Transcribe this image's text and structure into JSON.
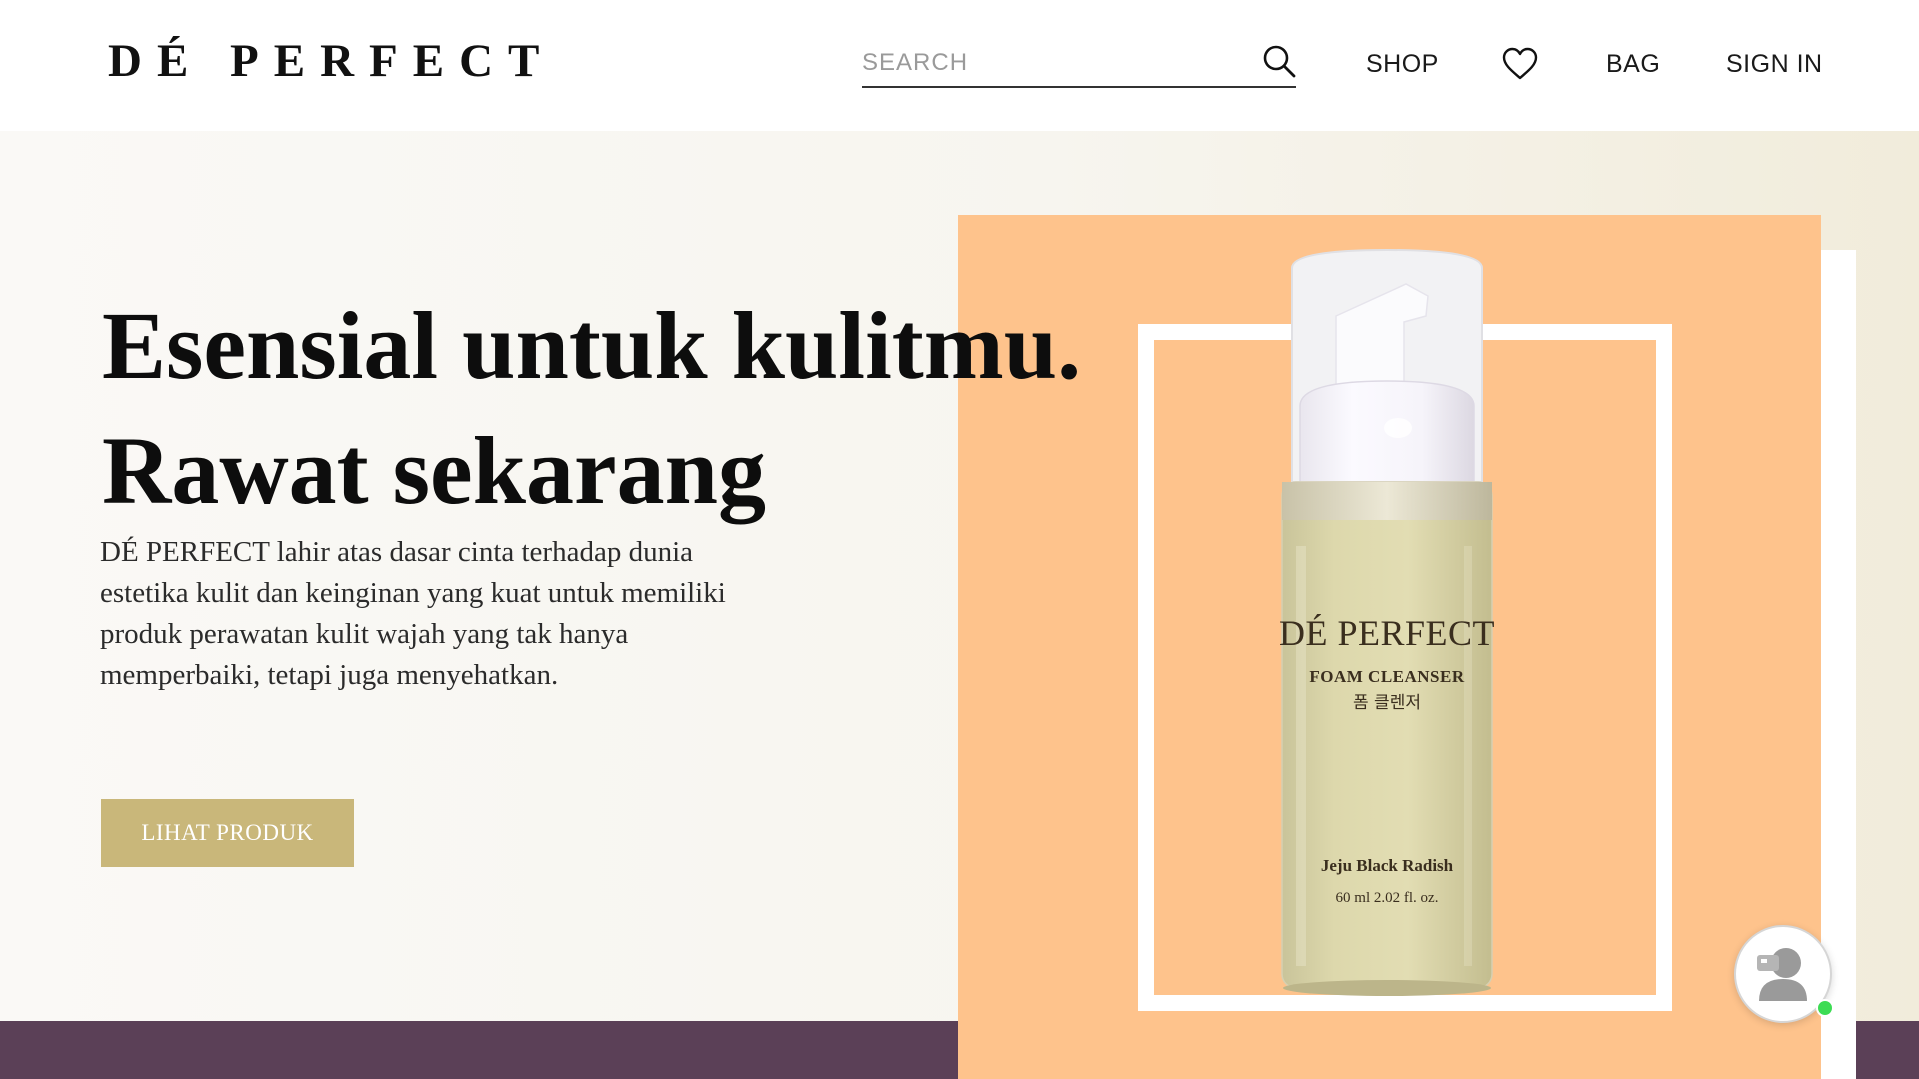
{
  "header": {
    "logo": "DÉ PERFECT",
    "search": {
      "placeholder": "SEARCH",
      "value": ""
    },
    "nav": {
      "shop": "SHOP",
      "bag": "BAG",
      "sign_in": "SIGN IN"
    }
  },
  "hero": {
    "title_line1": "Esensial untuk kulitmu.",
    "title_line2": "Rawat sekarang",
    "description": "DÉ PERFECT lahir atas dasar cinta terhadap dunia estetika kulit dan keinginan yang kuat untuk memiliki produk perawatan kulit wajah yang tak hanya memperbaiki, tetapi juga menyehatkan.",
    "cta_label": "LIHAT PRODUK"
  },
  "product": {
    "brand": "DÉ PERFECT",
    "type": "FOAM CLEANSER",
    "type_korean": "폼 클렌저",
    "variant": "Jeju Black Radish",
    "volume": "60 ml 2.02 fl. oz."
  },
  "colors": {
    "cta": "#c9b77a",
    "orange_panel": "#fec38c",
    "bottom_band": "#5b4057",
    "online_status": "#3ddc54"
  },
  "icons": {
    "search": "search-icon",
    "wishlist": "heart-icon",
    "chat": "chat-avatar-icon"
  }
}
